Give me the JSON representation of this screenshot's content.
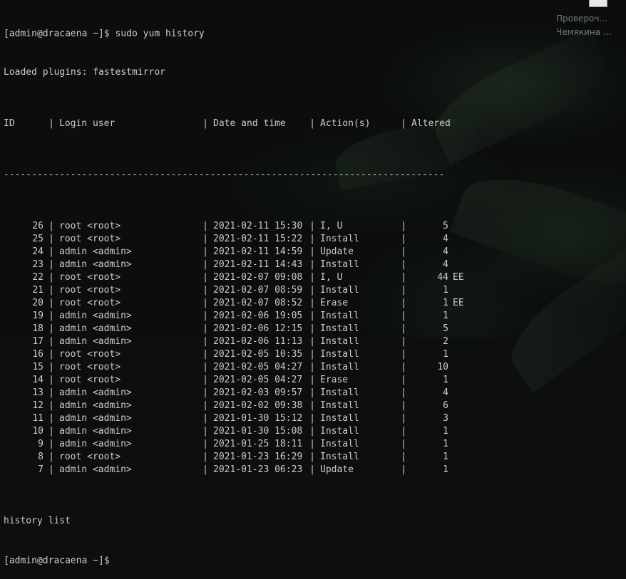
{
  "terminal": {
    "command_line": "[admin@dracaena ~]$ sudo yum history",
    "plugins_line": "Loaded plugins: fastestmirror",
    "headers": {
      "id": "ID",
      "login_user": "Login user",
      "date_time": "Date and time",
      "actions": "Action(s)",
      "altered": "Altered"
    },
    "separator": "-------------------------------------------------------------------------------",
    "rows": [
      {
        "id": "26",
        "login": "root <root>",
        "datetime": "2021-02-11 15:30",
        "action": "I, U",
        "altered": "5",
        "flag": ""
      },
      {
        "id": "25",
        "login": "root <root>",
        "datetime": "2021-02-11 15:22",
        "action": "Install",
        "altered": "4",
        "flag": ""
      },
      {
        "id": "24",
        "login": "admin <admin>",
        "datetime": "2021-02-11 14:59",
        "action": "Update",
        "altered": "4",
        "flag": ""
      },
      {
        "id": "23",
        "login": "admin <admin>",
        "datetime": "2021-02-11 14:43",
        "action": "Install",
        "altered": "4",
        "flag": ""
      },
      {
        "id": "22",
        "login": "root <root>",
        "datetime": "2021-02-07 09:08",
        "action": "I, U",
        "altered": "44",
        "flag": "EE"
      },
      {
        "id": "21",
        "login": "root <root>",
        "datetime": "2021-02-07 08:59",
        "action": "Install",
        "altered": "1",
        "flag": ""
      },
      {
        "id": "20",
        "login": "root <root>",
        "datetime": "2021-02-07 08:52",
        "action": "Erase",
        "altered": "1",
        "flag": "EE"
      },
      {
        "id": "19",
        "login": "admin <admin>",
        "datetime": "2021-02-06 19:05",
        "action": "Install",
        "altered": "1",
        "flag": ""
      },
      {
        "id": "18",
        "login": "admin <admin>",
        "datetime": "2021-02-06 12:15",
        "action": "Install",
        "altered": "5",
        "flag": ""
      },
      {
        "id": "17",
        "login": "admin <admin>",
        "datetime": "2021-02-06 11:13",
        "action": "Install",
        "altered": "2",
        "flag": ""
      },
      {
        "id": "16",
        "login": "root <root>",
        "datetime": "2021-02-05 10:35",
        "action": "Install",
        "altered": "1",
        "flag": ""
      },
      {
        "id": "15",
        "login": "root <root>",
        "datetime": "2021-02-05 04:27",
        "action": "Install",
        "altered": "10",
        "flag": ""
      },
      {
        "id": "14",
        "login": "root <root>",
        "datetime": "2021-02-05 04:27",
        "action": "Erase",
        "altered": "1",
        "flag": ""
      },
      {
        "id": "13",
        "login": "admin <admin>",
        "datetime": "2021-02-03 09:57",
        "action": "Install",
        "altered": "4",
        "flag": ""
      },
      {
        "id": "12",
        "login": "admin <admin>",
        "datetime": "2021-02-02 09:38",
        "action": "Install",
        "altered": "6",
        "flag": ""
      },
      {
        "id": "11",
        "login": "admin <admin>",
        "datetime": "2021-01-30 15:12",
        "action": "Install",
        "altered": "3",
        "flag": ""
      },
      {
        "id": "10",
        "login": "admin <admin>",
        "datetime": "2021-01-30 15:08",
        "action": "Install",
        "altered": "1",
        "flag": ""
      },
      {
        "id": "9",
        "login": "admin <admin>",
        "datetime": "2021-01-25 18:11",
        "action": "Install",
        "altered": "1",
        "flag": ""
      },
      {
        "id": "8",
        "login": "root <root>",
        "datetime": "2021-01-23 16:29",
        "action": "Install",
        "altered": "1",
        "flag": ""
      },
      {
        "id": "7",
        "login": "admin <admin>",
        "datetime": "2021-01-23 06:23",
        "action": "Update",
        "altered": "1",
        "flag": ""
      }
    ],
    "footer_line": "history list",
    "prompt_line": "[admin@dracaena ~]$"
  },
  "desktop_icon": {
    "label_line1": "Провероч...",
    "label_line2": "Чемякина ..."
  },
  "colors": {
    "text": "#cccccc",
    "background": "#0c0f0d"
  }
}
